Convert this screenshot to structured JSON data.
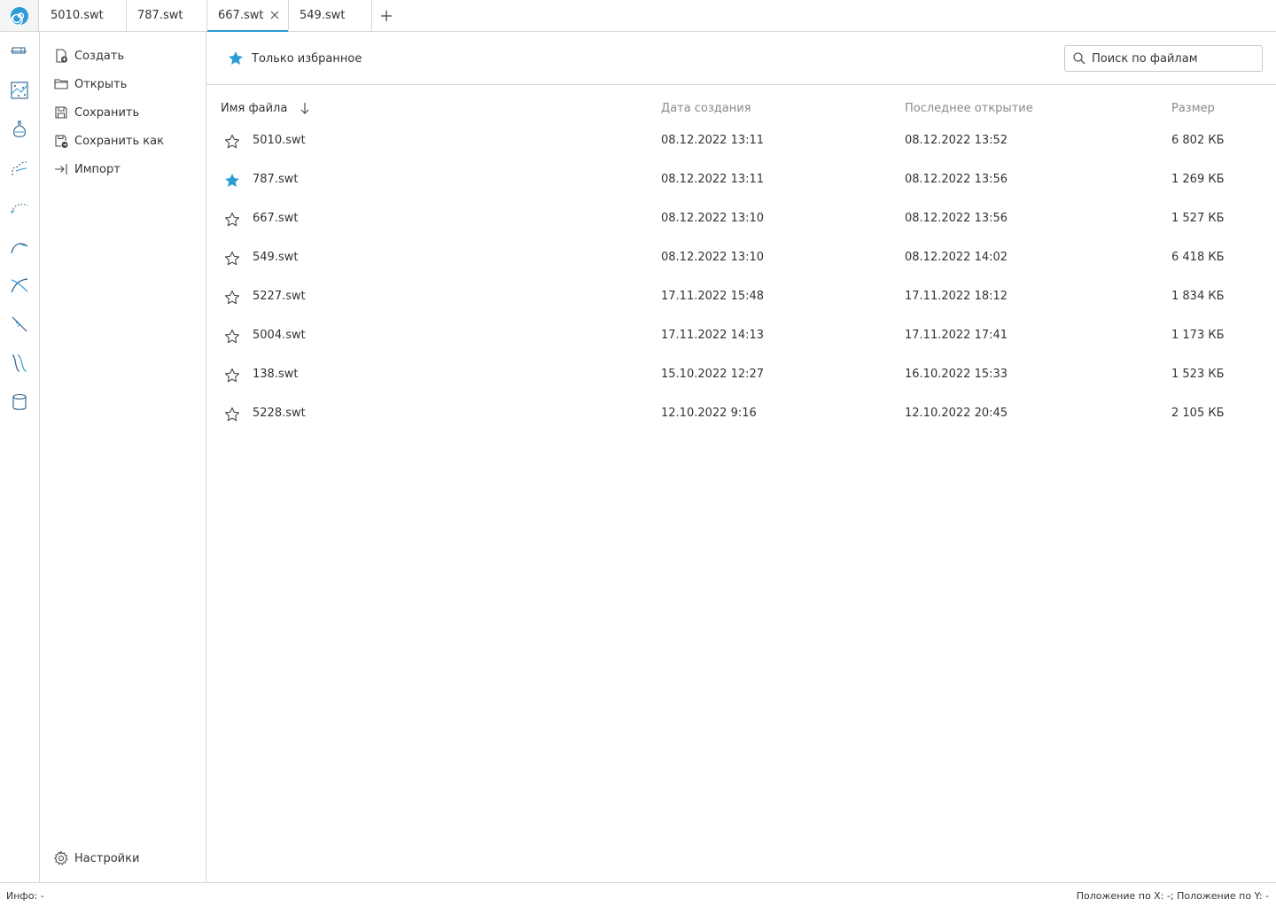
{
  "tabs": [
    {
      "label": "5010.swt"
    },
    {
      "label": "787.swt"
    },
    {
      "label": "667.swt",
      "active": true
    },
    {
      "label": "549.swt"
    }
  ],
  "rail_icons": [
    "rectangle-tool-icon",
    "scatter-map-icon",
    "flask-icon",
    "branch-curve-icon",
    "dotted-arc-icon",
    "curve-icon",
    "crossing-curves-icon",
    "diagonal-line-icon",
    "s-curves-icon",
    "database-icon"
  ],
  "file_menu": {
    "create": "Создать",
    "open": "Открыть",
    "save": "Сохранить",
    "save_as": "Сохранить как",
    "import": "Импорт",
    "settings": "Настройки"
  },
  "toolbar": {
    "favorites_only": "Только избранное",
    "search_placeholder": "Поиск по файлам"
  },
  "table": {
    "headers": {
      "name": "Имя файла",
      "created": "Дата создания",
      "last_opened": "Последнее открытие",
      "size": "Размер"
    },
    "sort": "name-descending",
    "rows": [
      {
        "favorite": false,
        "name": "5010.swt",
        "created": "08.12.2022 13:11",
        "last_opened": "08.12.2022 13:52",
        "size": "6 802 КБ"
      },
      {
        "favorite": true,
        "name": "787.swt",
        "created": "08.12.2022 13:11",
        "last_opened": "08.12.2022 13:56",
        "size": "1 269 КБ"
      },
      {
        "favorite": false,
        "name": "667.swt",
        "created": "08.12.2022 13:10",
        "last_opened": "08.12.2022 13:56",
        "size": "1 527 КБ"
      },
      {
        "favorite": false,
        "name": "549.swt",
        "created": "08.12.2022 13:10",
        "last_opened": "08.12.2022 14:02",
        "size": "6 418 КБ"
      },
      {
        "favorite": false,
        "name": "5227.swt",
        "created": "17.11.2022 15:48",
        "last_opened": "17.11.2022 18:12",
        "size": "1 834 КБ"
      },
      {
        "favorite": false,
        "name": "5004.swt",
        "created": "17.11.2022 14:13",
        "last_opened": "17.11.2022 17:41",
        "size": "1 173 КБ"
      },
      {
        "favorite": false,
        "name": "138.swt",
        "created": "15.10.2022 12:27",
        "last_opened": "16.10.2022 15:33",
        "size": "1 523 КБ"
      },
      {
        "favorite": false,
        "name": "5228.swt",
        "created": "12.10.2022 9:16",
        "last_opened": "12.10.2022 20:45",
        "size": "2 105 КБ"
      }
    ]
  },
  "statusbar": {
    "info": "Инфо: -",
    "position": "Положение по X: -; Положение по Y: -"
  },
  "colors": {
    "accent": "#2d9bd7",
    "border": "#d6d6d6",
    "muted_text": "#8a8a8a",
    "text": "#333333"
  }
}
